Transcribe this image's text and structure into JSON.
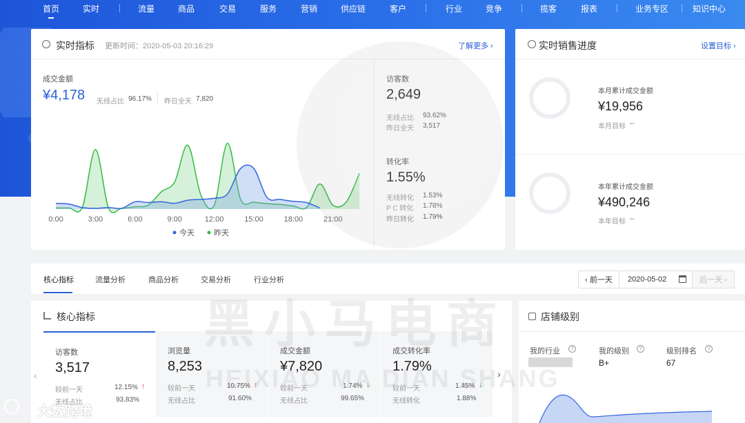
{
  "nav": {
    "items": [
      "首页",
      "实时",
      "流量",
      "商品",
      "交易",
      "服务",
      "营销",
      "供应链",
      "客户",
      "行业",
      "竞争",
      "揽客",
      "报表",
      "业务专区",
      "知识中心"
    ],
    "active": "首页"
  },
  "realtime": {
    "title": "实时指标",
    "updated": "更新时间：2020-05-03 20:16:29",
    "more": "了解更多 ›",
    "gmv_label": "成交金额",
    "gmv_value": "¥4,178",
    "gmv_mobile_label": "无线占比",
    "gmv_mobile_value": "96.17%",
    "gmv_yday_label": "昨日全天",
    "gmv_yday_value": "7,820",
    "visitors_label": "访客数",
    "visitors_value": "2,649",
    "visitors_mobile_label": "无线占比",
    "visitors_mobile_value": "93.62%",
    "visitors_yday_label": "昨日全天",
    "visitors_yday_value": "3,517",
    "conv_label": "转化率",
    "conv_value": "1.55%",
    "conv_mobile_label": "无线转化",
    "conv_mobile_value": "1.53%",
    "conv_pc_label": "P C 转化",
    "conv_pc_value": "1.78%",
    "conv_yday_label": "昨日转化",
    "conv_yday_value": "1.79%"
  },
  "sales": {
    "title": "实时销售进度",
    "set_goal": "设置目标 ›",
    "month_label": "本月累计成交金额",
    "month_value": "¥19,956",
    "month_goal_label": "本月目标",
    "month_goal_value": "--",
    "year_label": "本年累计成交金额",
    "year_value": "¥490,246",
    "year_goal_label": "本年目标",
    "year_goal_value": "--"
  },
  "tabs": [
    "核心指标",
    "流量分析",
    "商品分析",
    "交易分析",
    "行业分析"
  ],
  "date_nav": {
    "prev": "‹ 前一天",
    "date": "2020-05-02",
    "next": "后一天 ›"
  },
  "core": {
    "title": "核心指标",
    "metrics": [
      {
        "label": "访客数",
        "value": "3,517",
        "cmp_label": "较前一天",
        "cmp_value": "12.15%",
        "dir": "↑",
        "sub_label": "无线占比",
        "sub_value": "93.83%"
      },
      {
        "label": "浏览量",
        "value": "8,253",
        "cmp_label": "较前一天",
        "cmp_value": "10.75%",
        "dir": "↑",
        "sub_label": "无线占比",
        "sub_value": "91.60%"
      },
      {
        "label": "成交金额",
        "value": "¥7,820",
        "cmp_label": "较前一天",
        "cmp_value": "1.74%",
        "dir": "↓",
        "sub_label": "无线占比",
        "sub_value": "99.65%"
      },
      {
        "label": "成交转化率",
        "value": "1.79%",
        "cmp_label": "较前一天",
        "cmp_value": "1.45%",
        "dir": "↓",
        "sub_label": "无线转化",
        "sub_value": "1.88%"
      }
    ]
  },
  "shop": {
    "title": "店铺级别",
    "industry_label": "我的行业",
    "level_label": "我的级别",
    "level_value": "B+",
    "rank_label": "级别排名",
    "rank_value": "67"
  },
  "watermark": {
    "cn": "黑小马电商",
    "en": "HEIXIAO MA DIAN SHANG",
    "corner": "大数跨境"
  },
  "colors": {
    "today": "#3366dd",
    "yesterday": "#33bb44",
    "accent": "#2a5fd6",
    "up": "#e8443a",
    "down": "#2eb34a"
  },
  "chart_data": {
    "type": "area",
    "x_ticks": [
      "0:00",
      "3:00",
      "6:00",
      "9:00",
      "12:00",
      "15:00",
      "18:00",
      "21:00"
    ],
    "legend_position": "bottom",
    "grid": false,
    "series": [
      {
        "name": "今天",
        "color": "#3366dd",
        "x": [
          0,
          1,
          2,
          3,
          4,
          5,
          6,
          7,
          8,
          9,
          10,
          11,
          12,
          13,
          14,
          15,
          16,
          17,
          18,
          19,
          20
        ],
        "y": [
          150,
          130,
          40,
          20,
          40,
          20,
          190,
          170,
          190,
          150,
          230,
          250,
          280,
          390,
          1050,
          1050,
          300,
          250,
          200,
          170,
          30
        ]
      },
      {
        "name": "昨天",
        "color": "#33bb44",
        "x": [
          0,
          1,
          2,
          3,
          4,
          5,
          6,
          7,
          8,
          9,
          10,
          11,
          12,
          13,
          14,
          15,
          16,
          17,
          18,
          19,
          20,
          21,
          22,
          23
        ],
        "y": [
          30,
          30,
          40,
          1540,
          20,
          20,
          60,
          100,
          450,
          700,
          1650,
          350,
          100,
          1700,
          250,
          180,
          140,
          120,
          80,
          40,
          650,
          100,
          180,
          920
        ]
      }
    ]
  }
}
